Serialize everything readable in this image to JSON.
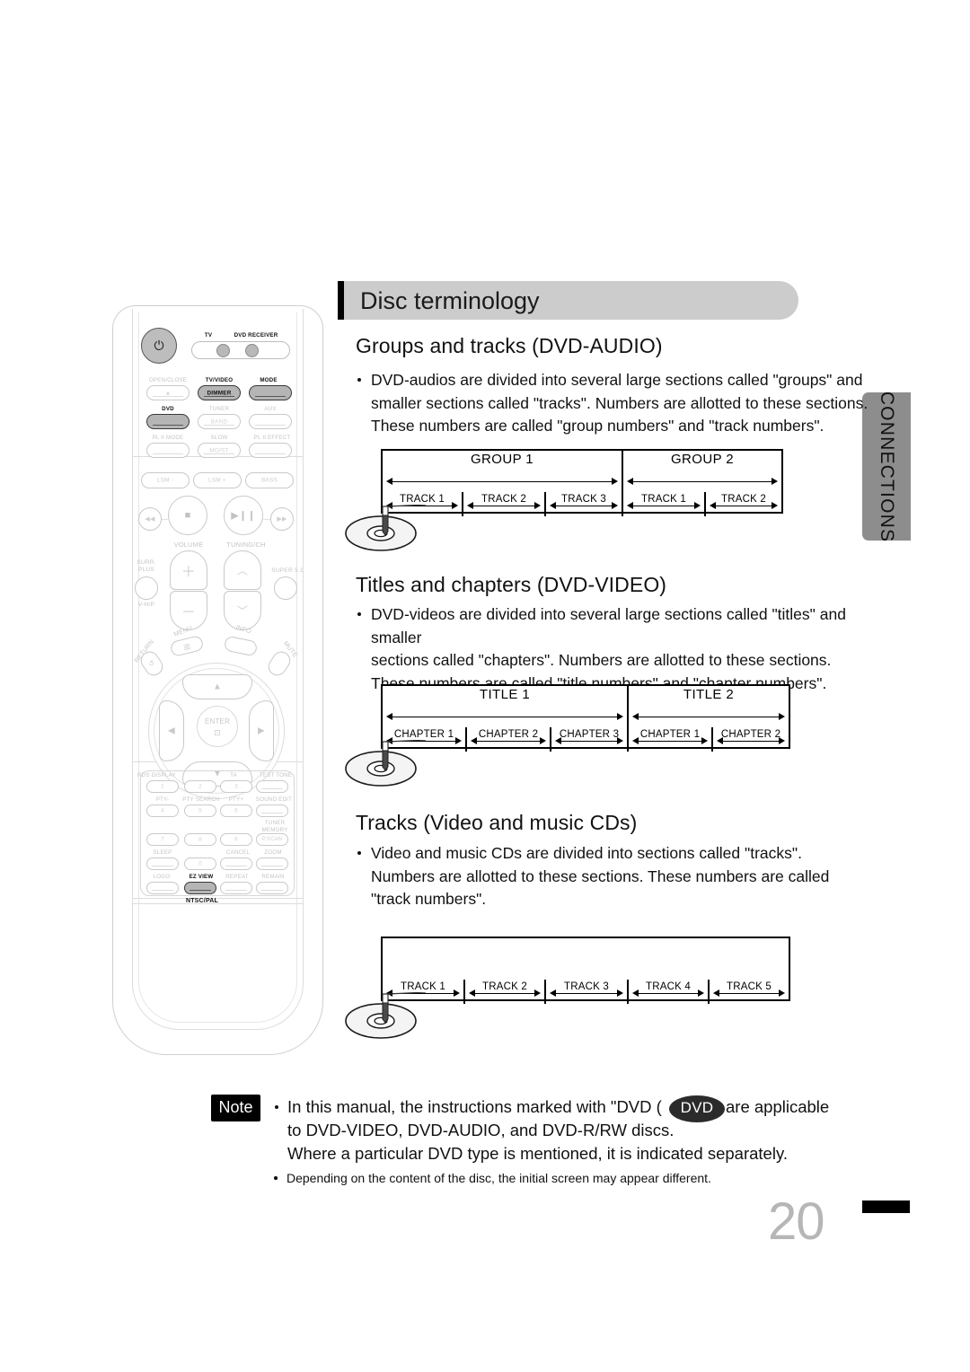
{
  "page": {
    "number": "20",
    "side_tab": "CONNECTIONS",
    "title": "Disc terminology"
  },
  "sections": [
    {
      "heading": "Groups and tracks (DVD-AUDIO)",
      "bullets": [
        "DVD-audios are divided into several large sections called \"groups\" and",
        "smaller sections called \"tracks\". Numbers are allotted to these sections.",
        "These numbers are called \"group numbers\" and \"track numbers\"."
      ]
    },
    {
      "heading": "Titles and chapters (DVD-VIDEO)",
      "bullets": [
        "DVD-videos are divided into several large sections called \"titles\" and smaller",
        "sections called \"chapters\". Numbers are allotted to these sections.",
        "These numbers are called \"title numbers\" and \"chapter numbers\"."
      ]
    },
    {
      "heading": "Tracks (Video and music CDs)",
      "bullets": [
        "Video and music CDs are divided into sections called \"tracks\".",
        "Numbers are allotted to these sections. These numbers are called",
        "\"track numbers\"."
      ]
    }
  ],
  "diagrams": [
    {
      "name": "groups-and-tracks",
      "top": [
        "GROUP 1",
        "GROUP 2"
      ],
      "top_spans": [
        3,
        2
      ],
      "bottom": [
        "TRACK 1",
        "TRACK 2",
        "TRACK 3",
        "TRACK 1",
        "TRACK 2"
      ]
    },
    {
      "name": "titles-and-chapters",
      "top": [
        "TITLE 1",
        "TITLE 2"
      ],
      "top_spans": [
        3,
        2
      ],
      "bottom": [
        "CHAPTER 1",
        "CHAPTER 2",
        "CHAPTER 3",
        "CHAPTER 1",
        "CHAPTER 2"
      ]
    },
    {
      "name": "tracks-cd",
      "top": [],
      "top_spans": [],
      "bottom": [
        "TRACK 1",
        "TRACK 2",
        "TRACK 3",
        "TRACK 4",
        "TRACK 5"
      ]
    }
  ],
  "note": {
    "badge": "Note",
    "lines": [
      "In this manual, the instructions marked with \"DVD (",
      "to DVD-VIDEO, DVD-AUDIO, and DVD-R/RW discs.",
      "Where a particular DVD type is mentioned, it is indicated separately."
    ],
    "oval_label": "DVD",
    "after_oval": "are applicable",
    "sub_line": "Depending on the content of the disc, the initial screen may appear different."
  },
  "remote": {
    "top_labels": {
      "tv": "TV",
      "dvd_receiver": "DVD RECEIVER"
    },
    "row1": [
      "OPEN/CLOSE",
      "TV/VIDEO",
      "MODE"
    ],
    "row1_inner": [
      "DIMMER"
    ],
    "row2": [
      "DVD",
      "TUNER",
      "AUX"
    ],
    "row2_inner": [
      "BAND"
    ],
    "row3": [
      "PL II MODE",
      "SLOW",
      "PL II EFFECT"
    ],
    "row3_inner": [
      "MO/ST"
    ],
    "row4": [
      "LSM -",
      "LSM +",
      "BASS"
    ],
    "transport": [
      "skip-back",
      "stop",
      "play-pause",
      "skip-forward"
    ],
    "volume_label": "VOLUME",
    "tuning_label": "TUNING/CH",
    "surr_plus": "SURR.\nPLUS",
    "super51": "SUPER 5.1",
    "vhp": "V-H/P",
    "menu": "MENU",
    "info": "INFO",
    "return": "RETURN",
    "mute": "MUTE",
    "enter": "ENTER",
    "keypad_upper": [
      "RDS DISPLAY",
      "",
      "TA",
      "TEST TONE",
      "PTY-",
      "PTY SEARCH",
      "PTY+",
      "SOUND EDIT",
      "",
      "",
      "",
      "TUNER MEMORY",
      "SLEEP",
      "",
      "CANCEL",
      "ZOOM",
      "LOGO",
      "EZ VIEW",
      "REPEAT",
      "REMAIN"
    ],
    "numbers": [
      "1",
      "2",
      "3",
      "4",
      "5",
      "6",
      "7",
      "8",
      "9",
      "0"
    ],
    "pscan": "P.SCAN",
    "ntsc_pal": "NTSC/PAL"
  },
  "colors": {
    "title_bar_bg": "#cccccc",
    "side_tab_bg": "#8d8d8d",
    "note_badge_bg": "#000000",
    "dvd_oval_bg": "#2b2b2b",
    "page_num": "#b6b6b6",
    "remote_outline": "#d6d6d6",
    "dark_button": "#b5b5b5"
  }
}
